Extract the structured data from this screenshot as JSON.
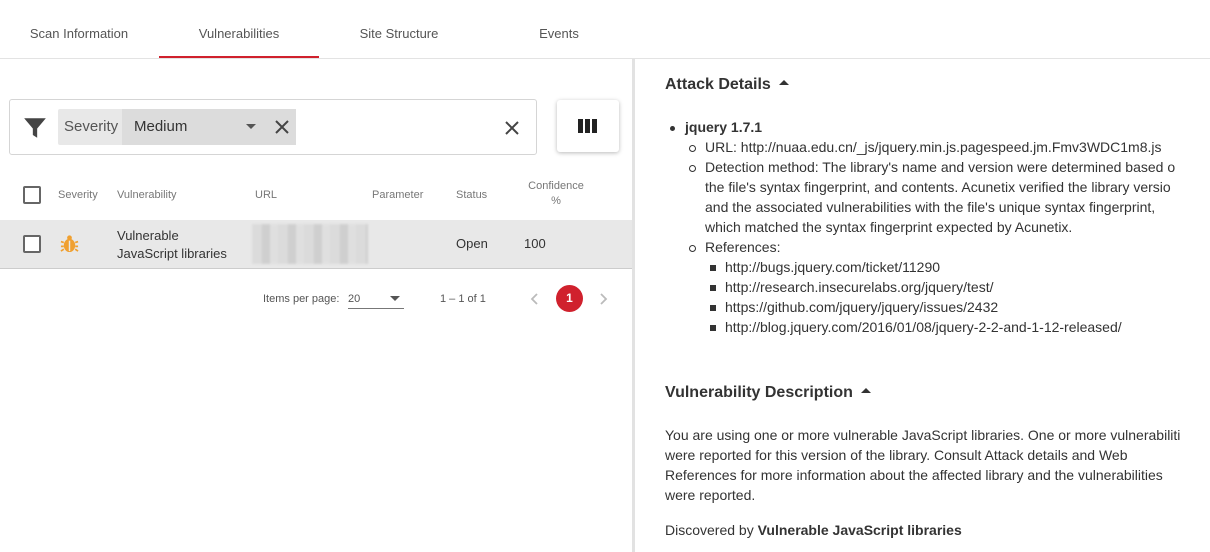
{
  "tabs": [
    {
      "label": "Scan Information"
    },
    {
      "label": "Vulnerabilities"
    },
    {
      "label": "Site Structure"
    },
    {
      "label": "Events"
    }
  ],
  "filter": {
    "field_label": "Severity",
    "value": "Medium"
  },
  "table": {
    "headers": [
      "Severity",
      "Vulnerability",
      "URL",
      "Parameter",
      "Status",
      "Confidence",
      "%"
    ],
    "rows": [
      {
        "severity": "medium",
        "vulnerability_line1": "Vulnerable",
        "vulnerability_line2": "JavaScript libraries",
        "url": "",
        "parameter": "",
        "status": "Open",
        "confidence": "100"
      }
    ]
  },
  "pagination": {
    "items_per_page_label": "Items per page:",
    "items_per_page": "20",
    "range": "1 – 1 of 1",
    "current_page": "1"
  },
  "attack_details": {
    "title": "Attack Details",
    "library": "jquery 1.7.1",
    "url_line": "URL: http://nuaa.edu.cn/_js/jquery.min.js.pagespeed.jm.Fmv3WDC1m8.js",
    "detection_lines": [
      "Detection method: The library's name and version were determined based o",
      "the file's syntax fingerprint, and contents. Acunetix verified the library versio",
      "and the associated vulnerabilities with the file's unique syntax fingerprint,",
      "which matched the syntax fingerprint expected by Acunetix."
    ],
    "references_label": "References:",
    "references": [
      "http://bugs.jquery.com/ticket/11290",
      "http://research.insecurelabs.org/jquery/test/",
      "https://github.com/jquery/jquery/issues/2432",
      "http://blog.jquery.com/2016/01/08/jquery-2-2-and-1-12-released/"
    ]
  },
  "vuln_description": {
    "title": "Vulnerability Description",
    "lines": [
      "You are using one or more vulnerable JavaScript libraries. One or more vulnerabiliti",
      "were reported for this version of the library. Consult Attack details and Web",
      "References for more information about the affected library and the vulnerabilities",
      "were reported."
    ],
    "discovered_prefix": "Discovered by ",
    "discovered_by": "Vulnerable JavaScript libraries"
  },
  "colors": {
    "accent": "#d0212d",
    "severity_medium": "#f0a030"
  }
}
